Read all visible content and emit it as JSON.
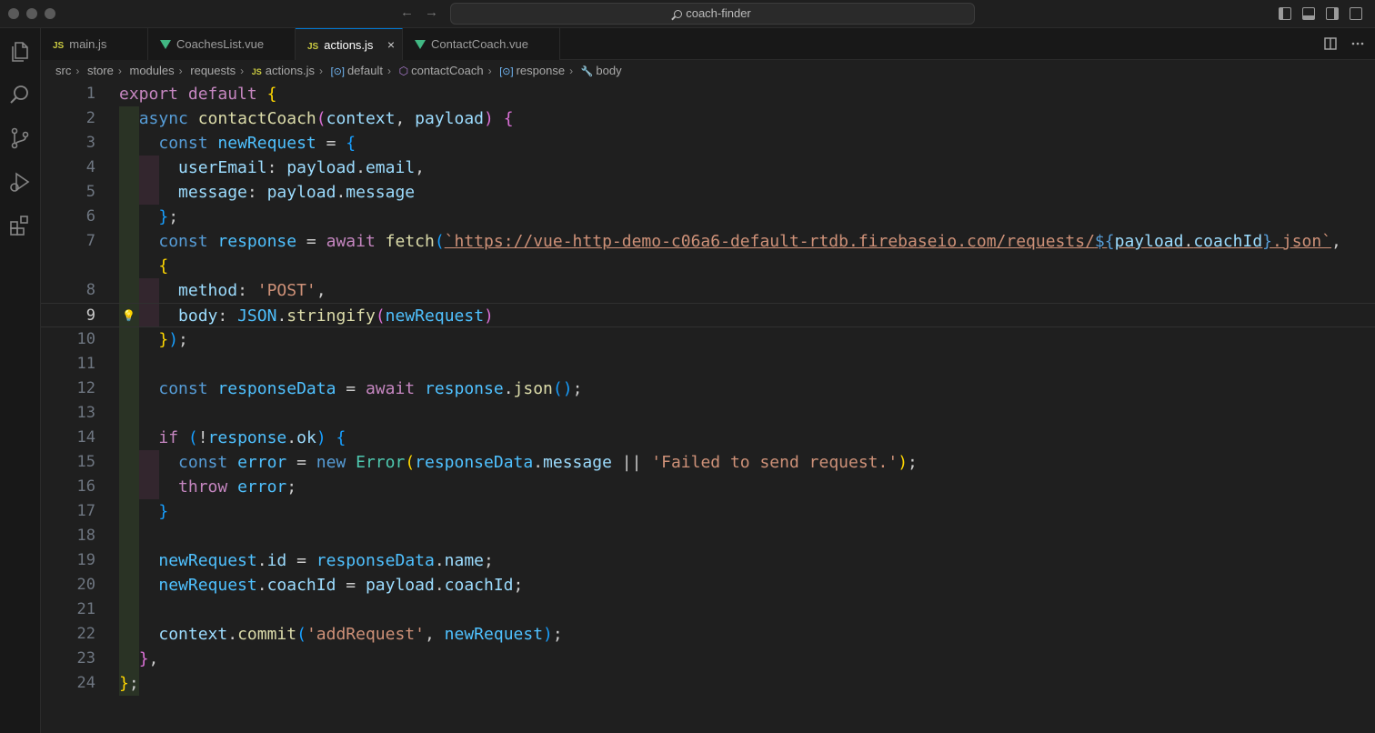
{
  "titlebar": {
    "search": "coach-finder",
    "back_arrow": "←",
    "forward_arrow": "→"
  },
  "activity": [
    "files-icon",
    "search-icon",
    "source-control-icon",
    "run-debug-icon",
    "extensions-icon"
  ],
  "tabs": [
    {
      "label": "main.js",
      "type": "js",
      "active": false
    },
    {
      "label": "CoachesList.vue",
      "type": "vue",
      "active": false
    },
    {
      "label": "actions.js",
      "type": "js",
      "active": true
    },
    {
      "label": "ContactCoach.vue",
      "type": "vue",
      "active": false
    }
  ],
  "tab_js_label": "JS",
  "tab_close": "×",
  "breadcrumb": [
    "src",
    "store",
    "modules",
    "requests",
    "actions.js",
    "default",
    "contactCoach",
    "response",
    "body"
  ],
  "breadcrumb_sep": "›",
  "editor": {
    "current_line": 9,
    "lightbulb": "💡",
    "line_numbers": [
      "1",
      "2",
      "3",
      "4",
      "5",
      "6",
      "7",
      "",
      "8",
      "9",
      "10",
      "11",
      "12",
      "13",
      "14",
      "15",
      "16",
      "17",
      "18",
      "19",
      "20",
      "21",
      "22",
      "23",
      "24"
    ],
    "tokens": {
      "l1": [
        "export",
        " ",
        "default",
        " ",
        "{"
      ],
      "l2": [
        "async",
        " ",
        "contactCoach",
        "(",
        "context",
        ", ",
        "payload",
        ")",
        " ",
        "{"
      ],
      "l3": [
        "const",
        " ",
        "newRequest",
        " = ",
        "{"
      ],
      "l4": [
        "userEmail",
        ": ",
        "payload",
        ".",
        "email",
        ","
      ],
      "l5": [
        "message",
        ": ",
        "payload",
        ".",
        "message"
      ],
      "l6": [
        "}",
        ";"
      ],
      "l7": [
        "const",
        " ",
        "response",
        " = ",
        "await",
        " ",
        "fetch",
        "(",
        "`https://vue-http-demo-c06a6-default-rtdb.firebaseio.com/requests/",
        "${",
        "payload",
        ".",
        "coachId",
        "}",
        ".json`",
        ","
      ],
      "l7b": [
        "{"
      ],
      "l8": [
        "method",
        ": ",
        "'POST'",
        ","
      ],
      "l9": [
        "body",
        ": ",
        "JSON",
        ".",
        "stringify",
        "(",
        "newRequest",
        ")"
      ],
      "l10": [
        "}",
        ")",
        ";"
      ],
      "l12": [
        "const",
        " ",
        "responseData",
        " = ",
        "await",
        " ",
        "response",
        ".",
        "json",
        "()",
        ";"
      ],
      "l14": [
        "if",
        " ",
        "(",
        "!",
        "response",
        ".",
        "ok",
        ")",
        " ",
        "{"
      ],
      "l15": [
        "const",
        " ",
        "error",
        " = ",
        "new",
        " ",
        "Error",
        "(",
        "responseData",
        ".",
        "message",
        " || ",
        "'Failed to send request.'",
        ")",
        ";"
      ],
      "l16": [
        "throw",
        " ",
        "error",
        ";"
      ],
      "l17": [
        "}"
      ],
      "l19": [
        "newRequest",
        ".",
        "id",
        " = ",
        "responseData",
        ".",
        "name",
        ";"
      ],
      "l20": [
        "newRequest",
        ".",
        "coachId",
        " = ",
        "payload",
        ".",
        "coachId",
        ";"
      ],
      "l22": [
        "context",
        ".",
        "commit",
        "(",
        "'addRequest'",
        ", ",
        "newRequest",
        ")",
        ";"
      ],
      "l23": [
        "}",
        ","
      ],
      "l24": [
        "}",
        ";"
      ]
    }
  },
  "colors": {
    "accent": "#0078d4",
    "keyword": "#569cd6",
    "control": "#c586c0",
    "function": "#dcdcaa",
    "variable": "#9cdcfe",
    "string": "#ce9178",
    "bracket_1": "#ffd700",
    "bracket_2": "#da70d6",
    "bracket_3": "#179fff"
  }
}
